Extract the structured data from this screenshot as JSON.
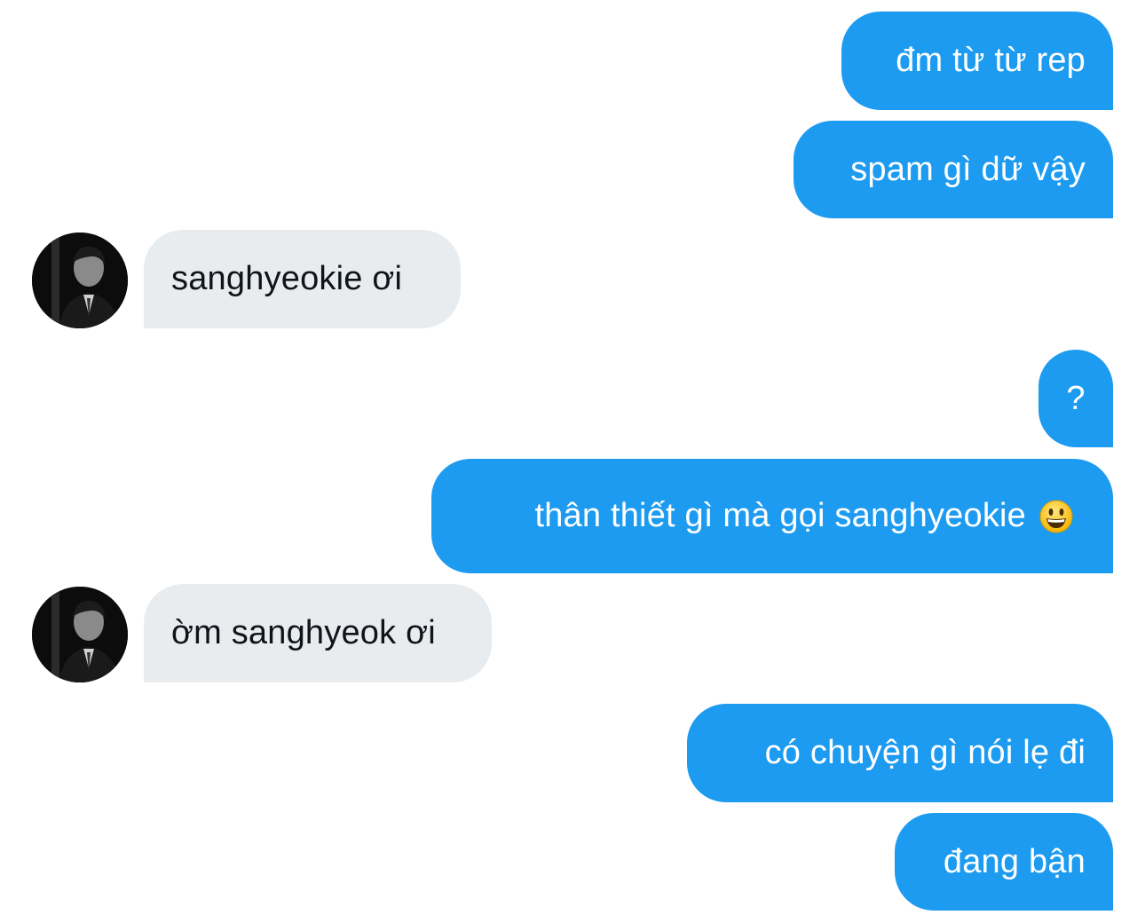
{
  "messages": [
    {
      "side": "sent",
      "text": "đm từ từ rep"
    },
    {
      "side": "sent",
      "text": "spam gì dữ vậy"
    },
    {
      "side": "received",
      "text": "sanghyeokie ơi"
    },
    {
      "side": "sent",
      "text": "?"
    },
    {
      "side": "sent",
      "text": "thân thiết gì mà gọi sanghyeokie",
      "emoji": "grinning-face-emoji"
    },
    {
      "side": "received",
      "text": "ờm sanghyeok ơi"
    },
    {
      "side": "sent",
      "text": "có chuyện gì nói lẹ đi"
    },
    {
      "side": "sent",
      "text": "đang bận"
    }
  ],
  "colors": {
    "sent_bubble": "#1d9bf0",
    "received_bubble": "#e8ecef",
    "received_text": "#0f1419"
  }
}
